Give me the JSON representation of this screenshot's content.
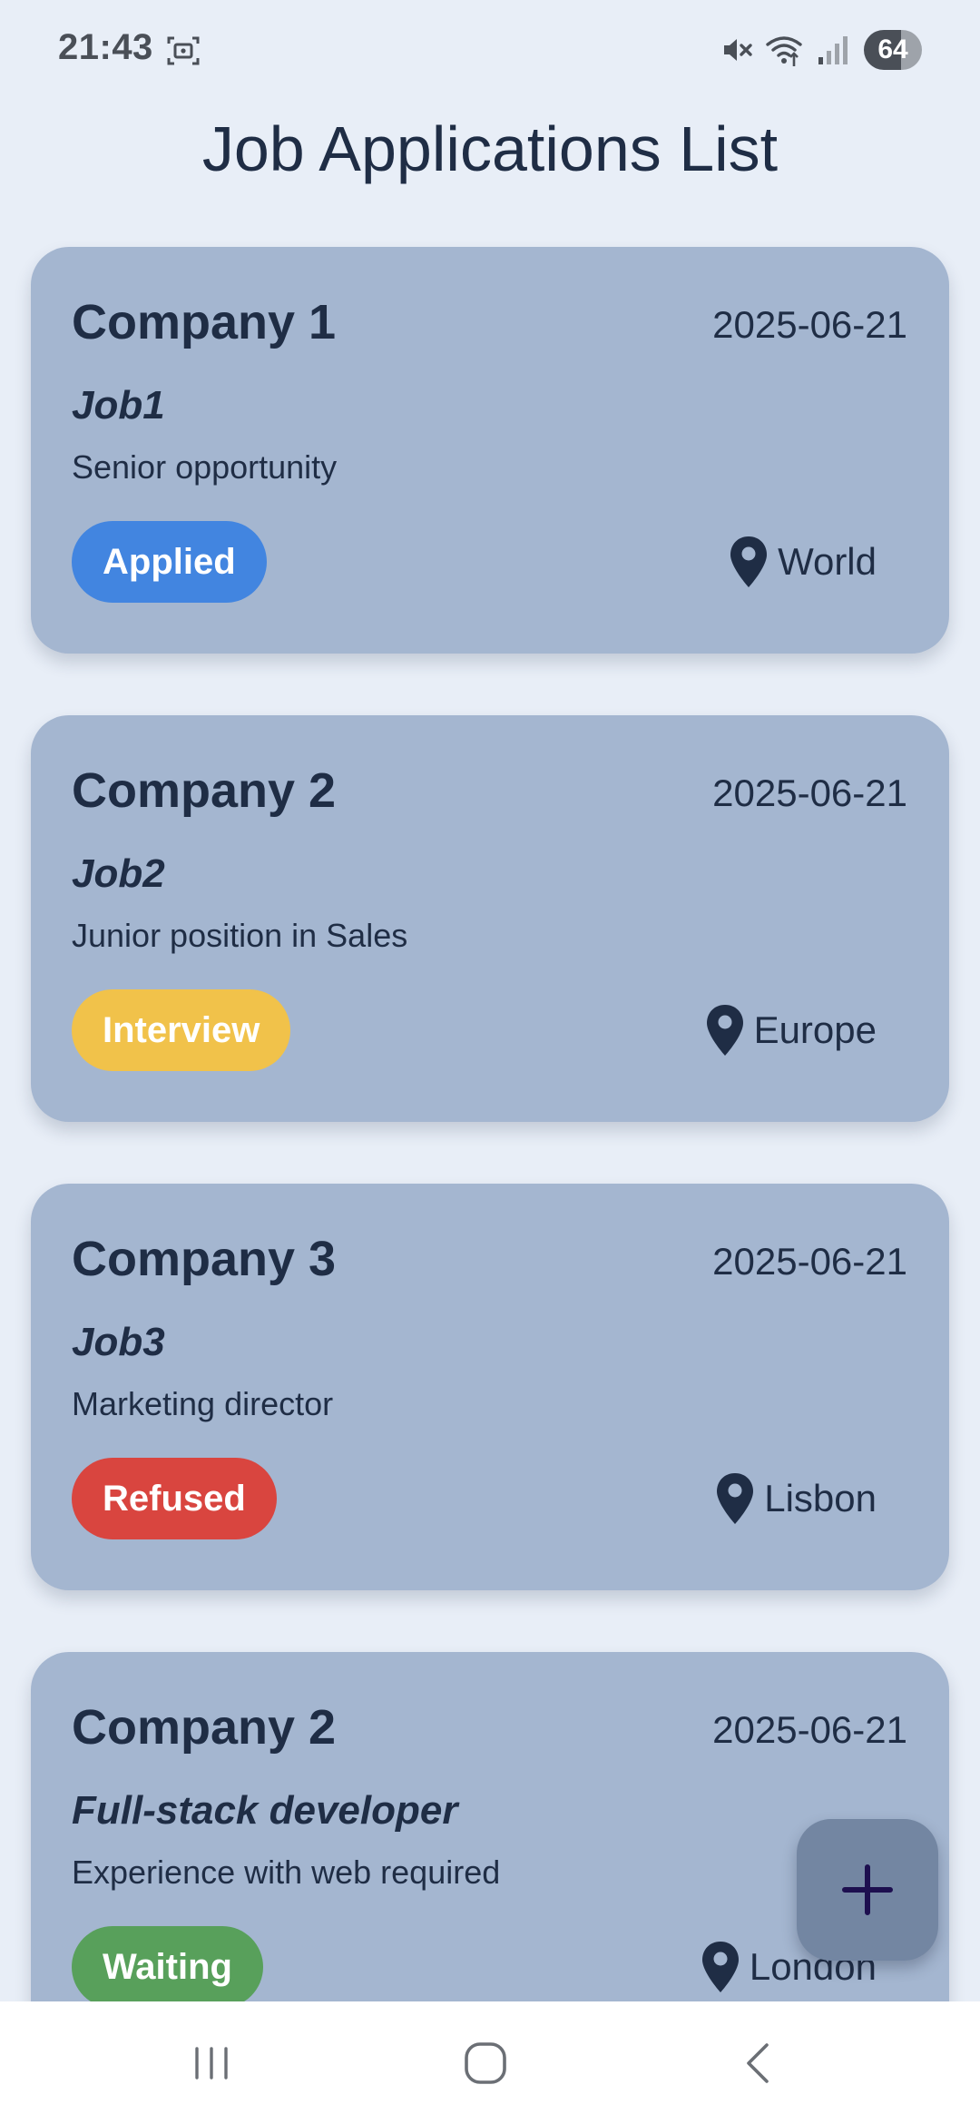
{
  "status_bar": {
    "time": "21:43",
    "battery": "64",
    "icons": [
      "screenshot-icon",
      "mute-icon",
      "wifi-icon",
      "signal-icon",
      "battery-icon"
    ]
  },
  "header": {
    "title": "Job Applications List"
  },
  "applications": [
    {
      "company": "Company 1",
      "date": "2025-06-21",
      "title": "Job1",
      "description": "Senior opportunity",
      "status": "Applied",
      "status_color": "#4285e0",
      "location": "World"
    },
    {
      "company": "Company 2",
      "date": "2025-06-21",
      "title": "Job2",
      "description": "Junior position in Sales",
      "status": "Interview",
      "status_color": "#f1c24a",
      "location": "Europe"
    },
    {
      "company": "Company 3",
      "date": "2025-06-21",
      "title": "Job3",
      "description": "Marketing director",
      "status": "Refused",
      "status_color": "#d9453f",
      "location": "Lisbon"
    },
    {
      "company": "Company 2",
      "date": "2025-06-21",
      "title": "Full-stack developer",
      "description": "Experience with web required",
      "status": "Waiting",
      "status_color": "#58a05b",
      "location": "London"
    }
  ],
  "fab": {
    "icon": "plus-icon",
    "color": "#7386a2"
  },
  "nav_bar": {
    "buttons": [
      "recent-apps-icon",
      "home-icon",
      "back-icon"
    ]
  },
  "colors": {
    "background": "#e8eef7",
    "card": "#a4b6d0",
    "text": "#1f2d45"
  }
}
